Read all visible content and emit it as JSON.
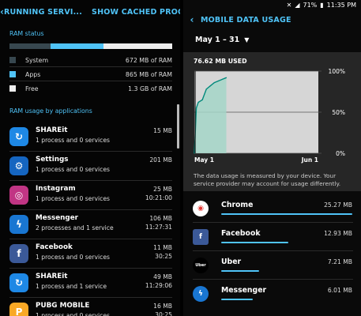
{
  "left": {
    "title": "RUNNING SERVI...",
    "action": "SHOW CACHED PROCESSES",
    "ram_status_label": "RAM status",
    "ram": [
      {
        "label": "System",
        "value": "672 MB of RAM",
        "color": "#37474f",
        "fraction": 0.25
      },
      {
        "label": "Apps",
        "value": "865 MB of RAM",
        "color": "#4fc3f7",
        "fraction": 0.33
      },
      {
        "label": "Free",
        "value": "1.3 GB of RAM",
        "color": "#eeeeee",
        "fraction": 0.42
      }
    ],
    "apps_label": "RAM usage by applications",
    "apps": [
      {
        "name": "SHAREit",
        "sub": "1 process and 0 services",
        "size": "15 MB",
        "time": "",
        "icon": "shareit-icon",
        "color": "#1e88e5",
        "glyph": "↻"
      },
      {
        "name": "Settings",
        "sub": "1 process and 0 services",
        "size": "201 MB",
        "time": "",
        "icon": "settings-icon",
        "color": "#1565c0",
        "glyph": "⚙"
      },
      {
        "name": "Instagram",
        "sub": "1 process and 0 services",
        "size": "25 MB",
        "time": "10:21:00",
        "icon": "instagram-icon",
        "color": "#c13584",
        "glyph": "◎"
      },
      {
        "name": "Messenger",
        "sub": "2 processes and 1 service",
        "size": "106 MB",
        "time": "11:27:31",
        "icon": "messenger-icon",
        "color": "#1976d2",
        "glyph": "ϟ"
      },
      {
        "name": "Facebook",
        "sub": "1 process and 0 services",
        "size": "11 MB",
        "time": "30:25",
        "icon": "facebook-icon",
        "color": "#3b5998",
        "glyph": "f"
      },
      {
        "name": "SHAREit",
        "sub": "1 process and 1 service",
        "size": "49 MB",
        "time": "11:29:06",
        "icon": "shareit-icon",
        "color": "#1e88e5",
        "glyph": "↻"
      },
      {
        "name": "PUBG MOBILE",
        "sub": "1 process and 0 services",
        "size": "16 MB",
        "time": "30:25",
        "icon": "pubg-icon",
        "color": "#f9a825",
        "glyph": "P"
      }
    ]
  },
  "right": {
    "status_time": "11:35 PM",
    "status_battery": "71%",
    "title": "MOBILE DATA USAGE",
    "date_range": "May 1 – 31",
    "used": "76.62 MB USED",
    "note": "The data usage is measured by your device. Your service provider may account for usage differently.",
    "usage": [
      {
        "name": "Chrome",
        "size": "25.27 MB",
        "fraction": 1.0,
        "icon": "chrome-icon",
        "bg": "#ffffff",
        "fg": "#e53935",
        "glyph": "◉"
      },
      {
        "name": "Facebook",
        "size": "12.93 MB",
        "fraction": 0.51,
        "icon": "facebook-icon",
        "bg": "#3b5998",
        "fg": "#ffffff",
        "glyph": "f"
      },
      {
        "name": "Uber",
        "size": "7.21 MB",
        "fraction": 0.29,
        "icon": "uber-icon",
        "bg": "#000000",
        "fg": "#ffffff",
        "glyph": "Uber"
      },
      {
        "name": "Messenger",
        "size": "6.01 MB",
        "fraction": 0.24,
        "icon": "messenger-icon",
        "bg": "#1976d2",
        "fg": "#ffffff",
        "glyph": "ϟ"
      }
    ]
  },
  "chart_data": {
    "type": "area",
    "x_labels": [
      "May 1",
      "Jun 1"
    ],
    "y_labels": [
      "100%",
      "50%",
      "0%"
    ],
    "ylim": [
      0,
      100
    ],
    "x": [
      1,
      1.2,
      1.5,
      2,
      3,
      4,
      5,
      6,
      7,
      8,
      9
    ],
    "y": [
      0,
      20,
      55,
      62,
      65,
      78,
      82,
      86,
      88,
      90,
      92
    ],
    "xlim": [
      1,
      32
    ],
    "grid": true
  }
}
